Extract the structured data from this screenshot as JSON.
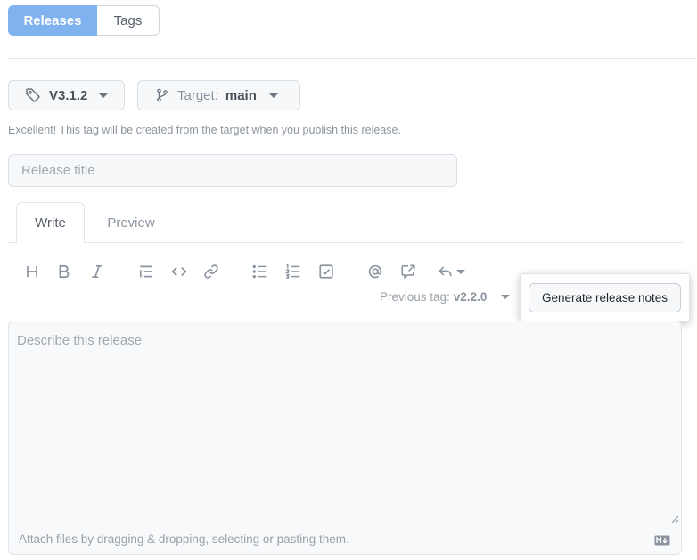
{
  "nav": {
    "releases_label": "Releases",
    "tags_label": "Tags"
  },
  "tag_picker": {
    "value": "V3.1.2",
    "icon": "tag-icon"
  },
  "target_picker": {
    "label": "Target:",
    "value": "main",
    "icon": "git-branch-icon"
  },
  "hint": "Excellent! This tag will be created from the target when you publish this release.",
  "release_title": {
    "placeholder": "Release title",
    "value": ""
  },
  "tabs": [
    {
      "label": "Write",
      "active": true
    },
    {
      "label": "Preview",
      "active": false
    }
  ],
  "toolbar": {
    "icons": [
      "heading-icon",
      "bold-icon",
      "italic-icon",
      "quote-icon",
      "code-icon",
      "link-icon",
      "bulleted-list-icon",
      "numbered-list-icon",
      "task-list-icon",
      "mention-icon",
      "cross-reference-icon",
      "reply-icon"
    ]
  },
  "previous_tag": {
    "label": "Previous tag:",
    "value": "v2.2.0"
  },
  "generate_button": {
    "label": "Generate release notes"
  },
  "description": {
    "placeholder": "Describe this release",
    "value": ""
  },
  "attach_hint": "Attach files by dragging & dropping, selecting or pasting them.",
  "markdown_icon": "markdown-icon",
  "colors": {
    "accent": "#7fb2ee",
    "border": "#d8dee4",
    "muted": "#8c959f"
  }
}
